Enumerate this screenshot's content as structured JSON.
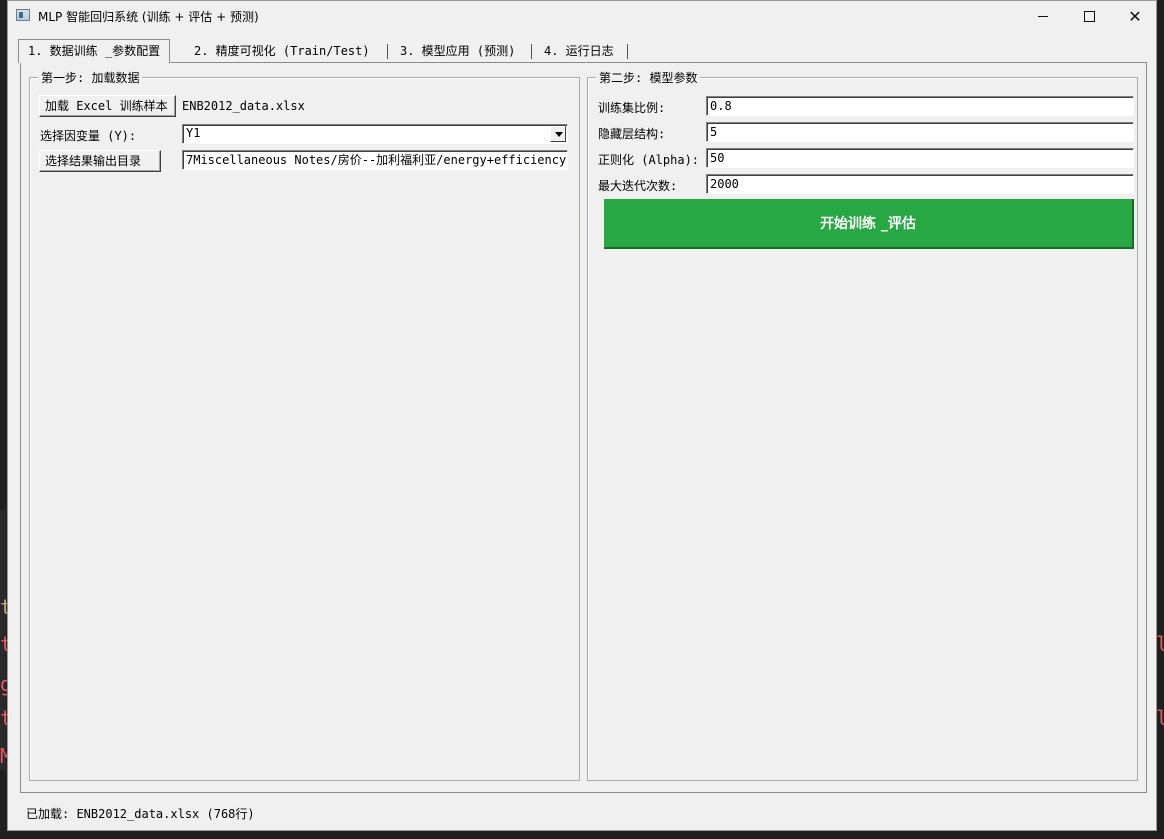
{
  "window": {
    "title": "MLP 智能回归系统 (训练 + 评估 + 预测)"
  },
  "tabs": [
    {
      "label": "1. 数据训练 _参数配置",
      "active": true
    },
    {
      "label": "2. 精度可视化 (Train/Test)",
      "active": false
    },
    {
      "label": "3. 模型应用 (预测)",
      "active": false
    },
    {
      "label": "4. 运行日志",
      "active": false
    }
  ],
  "step1": {
    "title": "第一步: 加载数据",
    "load_button": "加载 Excel 训练样本",
    "loaded_file": "ENB2012_data.xlsx",
    "target_label": "选择因变量 (Y):",
    "target_value": "Y1",
    "output_dir_button": "选择结果输出目录",
    "output_dir_value": "7Miscellaneous Notes/房价--加利福利亚/energy+efficiency"
  },
  "step2": {
    "title": "第二步: 模型参数",
    "params": [
      {
        "label": "训练集比例:",
        "value": "0.8"
      },
      {
        "label": "隐藏层结构:",
        "value": "5"
      },
      {
        "label": "正则化 (Alpha):",
        "value": "50"
      },
      {
        "label": "最大迭代次数:",
        "value": "2000"
      }
    ],
    "start_button": "开始训练 _评估"
  },
  "status": "已加载: ENB2012_data.xlsx (768行)",
  "colors": {
    "start_button": "#28a745",
    "background_terminal_text": "#e05a5a"
  }
}
